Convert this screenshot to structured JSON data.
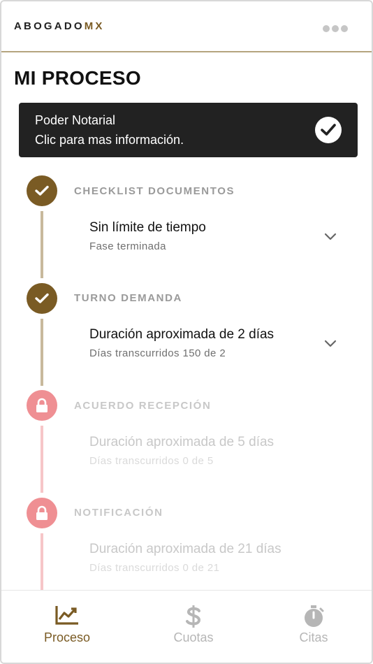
{
  "header": {
    "brand_main": "ABOGADO",
    "brand_accent": "MX",
    "menu_icon": "more-horizontal-icon"
  },
  "page": {
    "title": "MI PROCESO"
  },
  "banner": {
    "title": "Poder Notarial",
    "subtitle": "Clic para mas información.",
    "icon": "check-circle-icon"
  },
  "steps": [
    {
      "label": "CHECKLIST DOCUMENTOS",
      "main": "Sin límite de tiempo",
      "sub": "Fase terminada",
      "status": "done"
    },
    {
      "label": "TURNO DEMANDA",
      "main": "Duración aproximada de 2 días",
      "sub": "Días transcurridos 150 de 2",
      "status": "done"
    },
    {
      "label": "ACUERDO RECEPCIÓN",
      "main": "Duración aproximada de 5 días",
      "sub": "Días transcurridos 0 de 5",
      "status": "locked"
    },
    {
      "label": "NOTIFICACIÓN",
      "main": "Duración aproximada de 21 días",
      "sub": "Días transcurridos 0 de 21",
      "status": "locked"
    }
  ],
  "nav": {
    "items": [
      {
        "label": "Proceso",
        "icon": "chart-line-icon",
        "active": true
      },
      {
        "label": "Cuotas",
        "icon": "dollar-icon",
        "active": false
      },
      {
        "label": "Citas",
        "icon": "stopwatch-icon",
        "active": false
      }
    ]
  },
  "colors": {
    "accent": "#7a5b24",
    "locked": "#ef8f93",
    "banner_bg": "#222222",
    "header_rule": "#b5a57e"
  }
}
